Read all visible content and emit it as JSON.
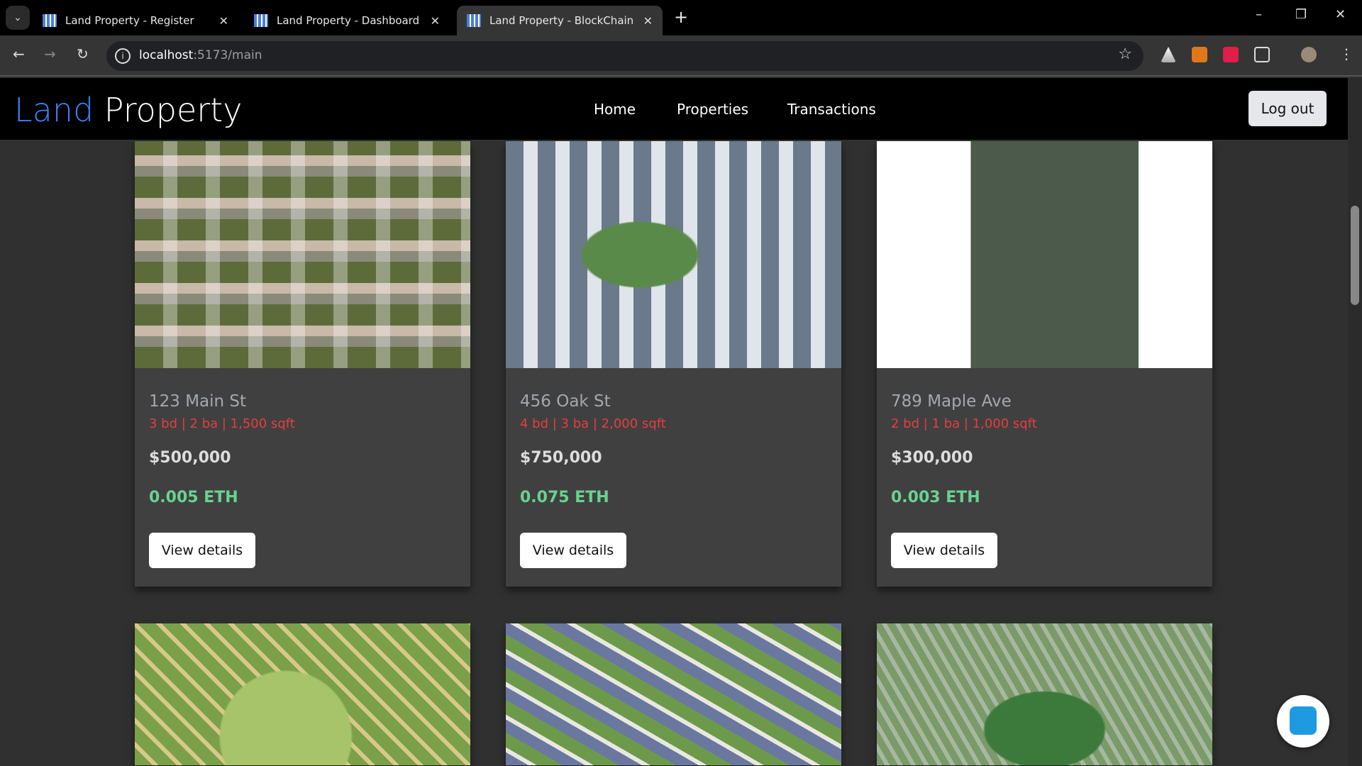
{
  "browser": {
    "tabs": [
      {
        "title": "Land Property - Register"
      },
      {
        "title": "Land Property - Dashboard"
      },
      {
        "title": "Land Property - BlockChain"
      }
    ],
    "url_host": "localhost",
    "url_path": ":5173/main"
  },
  "header": {
    "logo_a": "Land",
    "logo_b": " Property",
    "nav": [
      "Home",
      "Properties",
      "Transactions"
    ],
    "logout": "Log out"
  },
  "properties": [
    {
      "title": "123 Main St",
      "specs": "3 bd | 2 ba | 1,500 sqft",
      "price": "$500,000",
      "eth": "0.005 ETH",
      "button": "View details"
    },
    {
      "title": "456 Oak St",
      "specs": "4 bd | 3 ba | 2,000 sqft",
      "price": "$750,000",
      "eth": "0.075 ETH",
      "button": "View details"
    },
    {
      "title": "789 Maple Ave",
      "specs": "2 bd | 1 ba | 1,000 sqft",
      "price": "$300,000",
      "eth": "0.003 ETH",
      "button": "View details"
    }
  ],
  "colors": {
    "accent": "#3b82f6",
    "specs": "#e53e3e",
    "eth": "#68d391"
  }
}
